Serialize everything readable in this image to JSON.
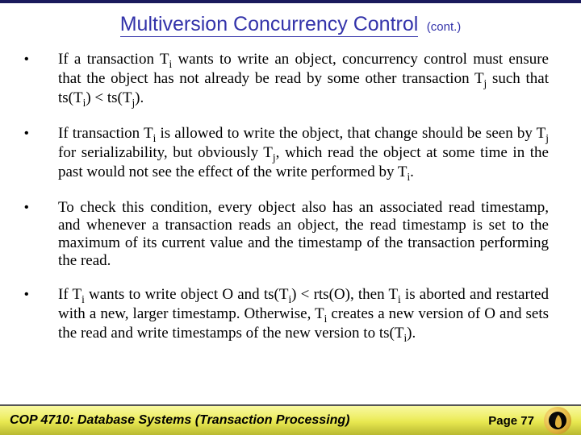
{
  "title": {
    "main": "Multiversion Concurrency Control",
    "suffix": "(cont.)"
  },
  "bullets": [
    {
      "html": "If a transaction T<span class=\"sub\">i</span> wants to write an object, concurrency control must ensure that the object has not already be read by some other transaction T<span class=\"sub\">j</span> such that ts(T<span class=\"sub\">i</span>) &lt; ts(T<span class=\"sub\">j</span>)."
    },
    {
      "html": "If transaction T<span class=\"sub\">i</span> is allowed to write the object, that change should be seen by T<span class=\"sub\">j</span> for serializability, but obviously T<span class=\"sub\">j</span>, which read the object at some time in the past would not see the effect of the write performed by T<span class=\"sub\">i</span>."
    },
    {
      "html": "To check this condition, every object also has an associated read timestamp, and whenever a transaction reads an object, the read timestamp is set to the maximum of its current value and the timestamp of the transaction performing the read."
    },
    {
      "html": "If T<span class=\"sub\">i</span> wants to write object O and ts(T<span class=\"sub\">i</span>) &lt; rts(O), then T<span class=\"sub\">i</span> is aborted and restarted with a new, larger timestamp.  Otherwise, T<span class=\"sub\">i</span> creates a new version of O and sets the read and write timestamps of the new version to ts(T<span class=\"sub\">i</span>)."
    }
  ],
  "footer": {
    "course": "COP 4710: Database Systems  (Transaction Processing)",
    "page": "Page 77"
  }
}
